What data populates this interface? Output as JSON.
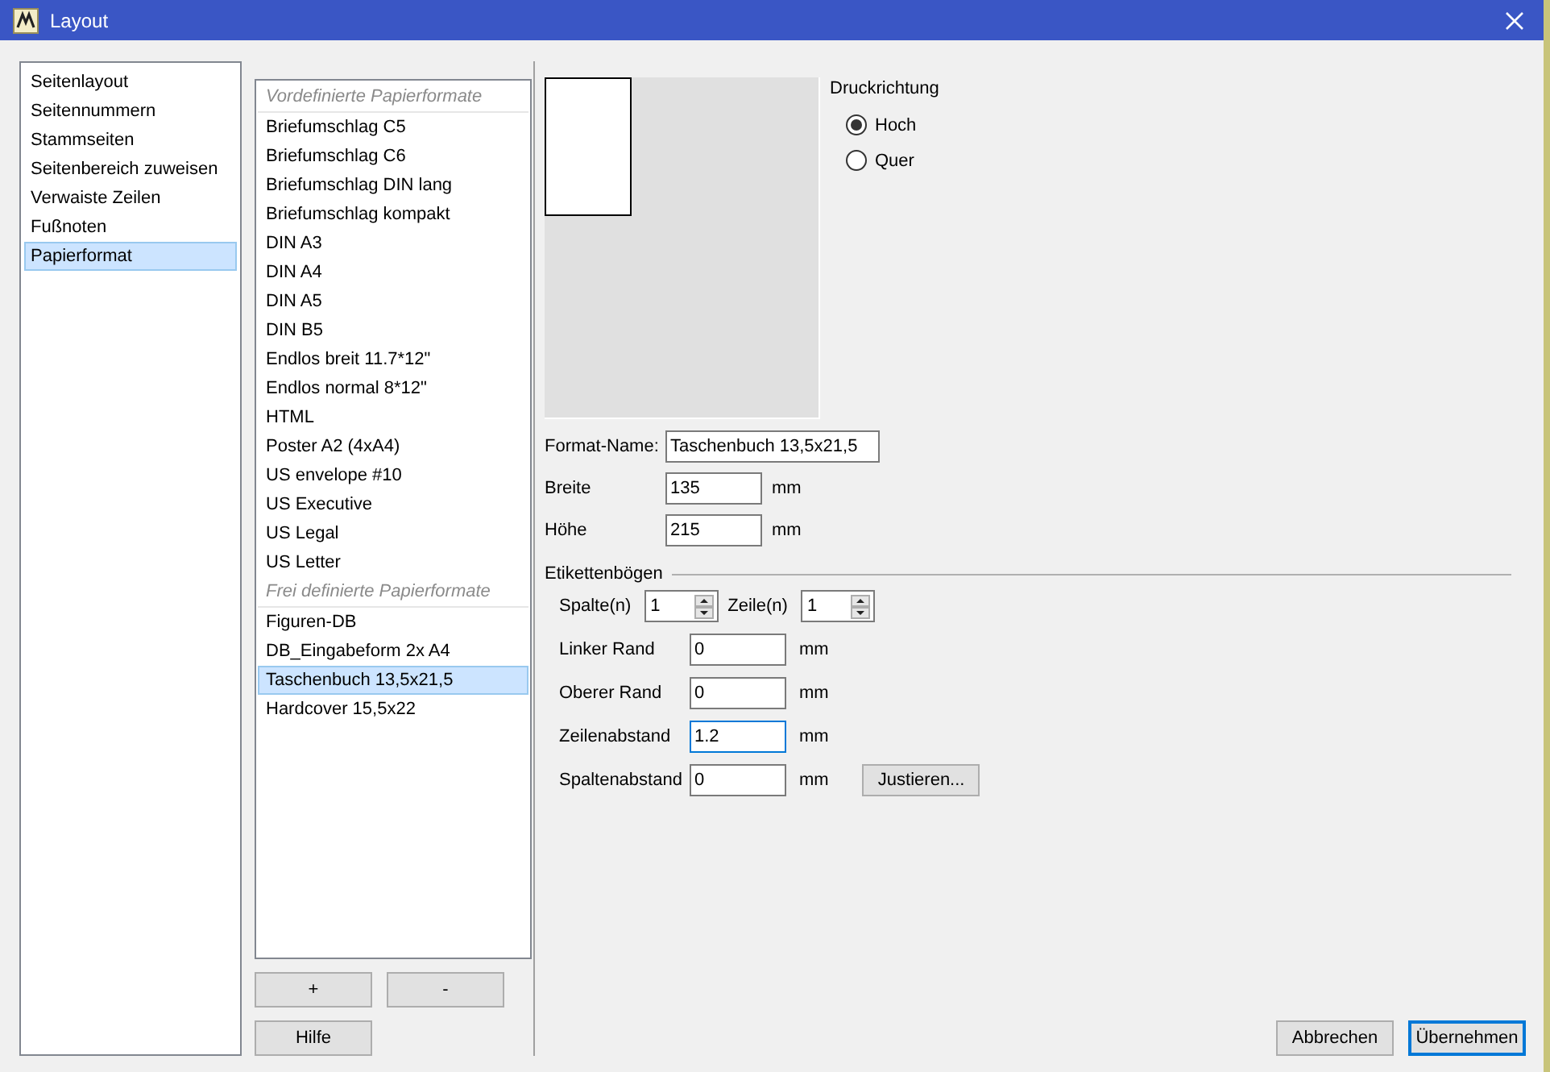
{
  "window": {
    "title": "Layout"
  },
  "nav": {
    "items": [
      {
        "label": "Seitenlayout",
        "selected": false
      },
      {
        "label": "Seitennummern",
        "selected": false
      },
      {
        "label": "Stammseiten",
        "selected": false
      },
      {
        "label": "Seitenbereich zuweisen",
        "selected": false
      },
      {
        "label": "Verwaiste Zeilen",
        "selected": false
      },
      {
        "label": "Fußnoten",
        "selected": false
      },
      {
        "label": "Papierformat",
        "selected": true
      }
    ]
  },
  "formats": {
    "groups": [
      {
        "header": "Vordefinierte Papierformate",
        "items": [
          {
            "label": "Briefumschlag C5",
            "selected": false
          },
          {
            "label": "Briefumschlag C6",
            "selected": false
          },
          {
            "label": "Briefumschlag DIN lang",
            "selected": false
          },
          {
            "label": "Briefumschlag kompakt",
            "selected": false
          },
          {
            "label": "DIN A3",
            "selected": false
          },
          {
            "label": "DIN A4",
            "selected": false
          },
          {
            "label": "DIN A5",
            "selected": false
          },
          {
            "label": "DIN B5",
            "selected": false
          },
          {
            "label": "Endlos breit 11.7*12\"",
            "selected": false
          },
          {
            "label": "Endlos normal 8*12\"",
            "selected": false
          },
          {
            "label": "HTML",
            "selected": false
          },
          {
            "label": "Poster A2 (4xA4)",
            "selected": false
          },
          {
            "label": "US envelope #10",
            "selected": false
          },
          {
            "label": "US Executive",
            "selected": false
          },
          {
            "label": "US Legal",
            "selected": false
          },
          {
            "label": "US Letter",
            "selected": false
          }
        ]
      },
      {
        "header": "Frei definierte Papierformate",
        "items": [
          {
            "label": "Figuren-DB",
            "selected": false
          },
          {
            "label": "DB_Eingabeform 2x A4",
            "selected": false
          },
          {
            "label": "Taschenbuch 13,5x21,5",
            "selected": true
          },
          {
            "label": "Hardcover 15,5x22",
            "selected": false
          }
        ]
      }
    ],
    "buttons": [
      "+",
      "-"
    ]
  },
  "orientation": {
    "title": "Druckrichtung",
    "options": [
      {
        "label": "Hoch",
        "selected": true
      },
      {
        "label": "Quer",
        "selected": false
      }
    ]
  },
  "format_name": {
    "label": "Format-Name:",
    "value": "Taschenbuch 13,5x21,5"
  },
  "size_fields": [
    {
      "label": "Breite",
      "value": "135",
      "unit": "mm"
    },
    {
      "label": "Höhe",
      "value": "215",
      "unit": "mm"
    }
  ],
  "labels": {
    "title": "Etikettenbögen",
    "spinners": [
      {
        "label": "Spalte(n)",
        "value": "1"
      },
      {
        "label": "Zeile(n)",
        "value": "1"
      }
    ],
    "fields": [
      {
        "label": "Linker Rand",
        "value": "0",
        "unit": "mm",
        "focused": false
      },
      {
        "label": "Oberer Rand",
        "value": "0",
        "unit": "mm",
        "focused": false
      },
      {
        "label": "Zeilenabstand",
        "value": "1.2",
        "unit": "mm",
        "focused": true
      },
      {
        "label": "Spaltenabstand",
        "value": "0",
        "unit": "mm",
        "focused": false
      }
    ],
    "adjust_button": "Justieren..."
  },
  "help_button": "Hilfe",
  "footer_buttons": [
    {
      "label": "Abbrechen",
      "default": false
    },
    {
      "label": "Übernehmen",
      "default": true
    }
  ]
}
